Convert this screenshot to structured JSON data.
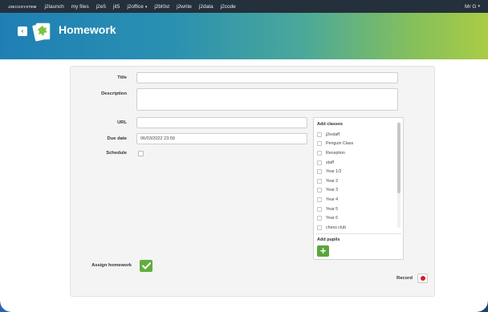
{
  "topbar": {
    "brand": "J2ECOSYSTEM",
    "nav": [
      "j2launch",
      "my files",
      "j2e5",
      "jit5",
      "j2office",
      "j2bl0st",
      "j2write",
      "j2data",
      "j2code"
    ],
    "user": "Mr G"
  },
  "header": {
    "title": "Homework",
    "back_icon": "back-arrow-icon",
    "logo_icon": "homework-logo-icon",
    "gradient_start": "#1f7fb4",
    "gradient_end": "#a9cc45"
  },
  "form": {
    "title_label": "Title",
    "title_value": "",
    "description_label": "Description",
    "description_value": "",
    "url_label": "URL",
    "url_value": "",
    "due_date_label": "Due date",
    "due_date_value": "06/03/2022 23:59",
    "schedule_label": "Schedule",
    "assign_label": "Assign homework",
    "record_label": "Record"
  },
  "classes": {
    "title": "Add classes",
    "items": [
      "j2estaff",
      "Penguin Class",
      "Reception",
      "staff",
      "Year 1/2",
      "Year 2",
      "Year 3",
      "Year 4",
      "Year 5",
      "Year 6",
      "chess club"
    ]
  },
  "pupils": {
    "title": "Add pupils",
    "add_icon": "plus-icon"
  },
  "colors": {
    "topbar": "#24303b",
    "accent_green": "#62ad3f",
    "record_red": "#d01e2a"
  }
}
